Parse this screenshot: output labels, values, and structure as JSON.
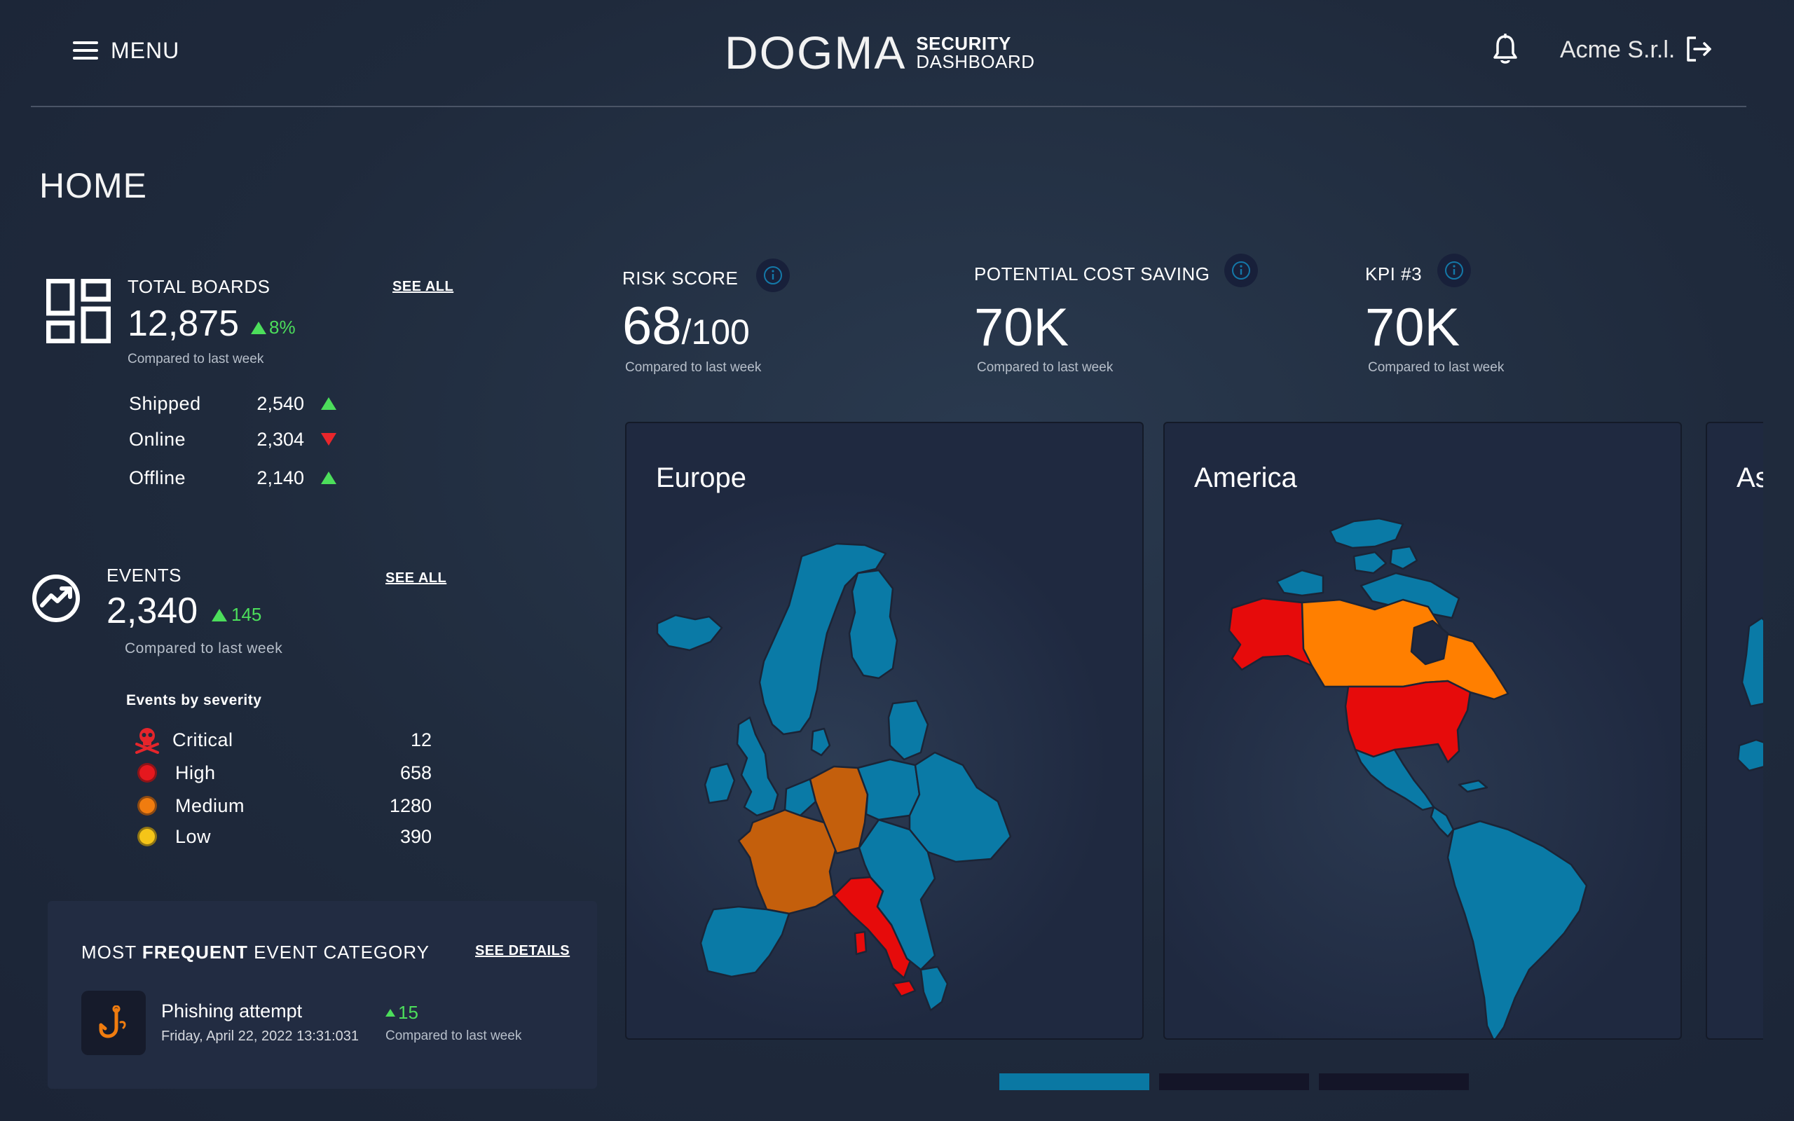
{
  "header": {
    "menu_label": "MENU",
    "logo_word": "DOGMA",
    "logo_line1": "SECURITY",
    "logo_line2": "DASHBOARD",
    "company": "Acme S.r.l."
  },
  "page_title": "HOME",
  "total_boards": {
    "label": "TOTAL BOARDS",
    "see_all": "SEE ALL",
    "value": "12,875",
    "change": "8%",
    "compared": "Compared to last week",
    "rows": [
      {
        "name": "Shipped",
        "value": "2,540",
        "trend": "up"
      },
      {
        "name": "Online",
        "value": "2,304",
        "trend": "down"
      },
      {
        "name": "Offline",
        "value": "2,140",
        "trend": "up"
      }
    ]
  },
  "events": {
    "label": "EVENTS",
    "see_all": "SEE ALL",
    "value": "2,340",
    "change": "145",
    "compared": "Compared to last week",
    "severity_title": "Events by severity",
    "severity": [
      {
        "name": "Critical",
        "value": "12",
        "color": "#e5252b",
        "icon": "skull-icon"
      },
      {
        "name": "High",
        "value": "658",
        "color": "#e5181e"
      },
      {
        "name": "Medium",
        "value": "1280",
        "color": "#f07c0f"
      },
      {
        "name": "Low",
        "value": "390",
        "color": "#f5c518"
      }
    ]
  },
  "frequent": {
    "title_pre": "MOST ",
    "title_bold": "FREQUENT",
    "title_post": " EVENT CATEGORY",
    "see_details": "SEE DETAILS",
    "name": "Phishing attempt",
    "date": "Friday, April 22, 2022 13:31:031",
    "change": "15",
    "compared": "Compared to last week"
  },
  "kpis": [
    {
      "label": "RISK SCORE",
      "value": "68",
      "denominator": "/100",
      "compared": "Compared to last week"
    },
    {
      "label": "POTENTIAL COST SAVING",
      "value": "70K",
      "compared": "Compared to last week"
    },
    {
      "label": "KPI #3",
      "value": "70K",
      "compared": "Compared to last week"
    }
  ],
  "maps": [
    {
      "title": "Europe"
    },
    {
      "title": "America"
    },
    {
      "title": "As"
    }
  ],
  "colors": {
    "map_blue": "#0a7aa6",
    "map_orange": "#ff7f00",
    "map_dark_orange": "#c45f0c",
    "map_red": "#e60b0b",
    "up_green": "#4cde5b",
    "down_red": "#e9262b",
    "pager_active": "#0a78a3",
    "pager_inactive": "#141528"
  }
}
